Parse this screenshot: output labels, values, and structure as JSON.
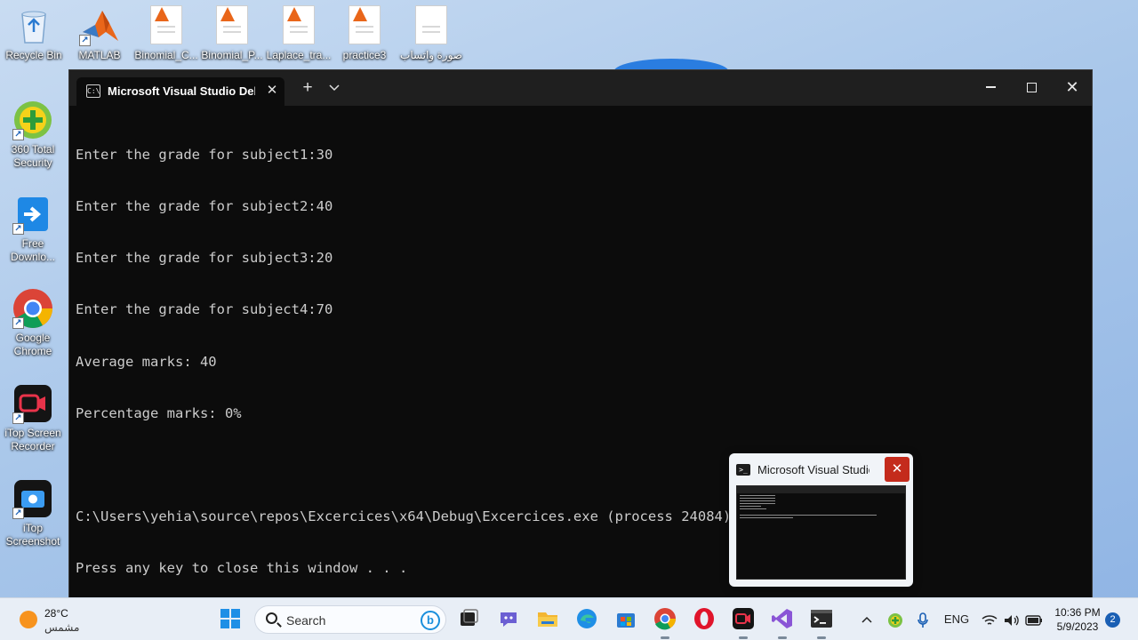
{
  "desktop": {
    "icons": [
      {
        "label": "Recycle Bin",
        "icon": "recycle-bin-icon"
      },
      {
        "label": "MATLAB",
        "icon": "matlab-icon"
      },
      {
        "label": "Binomial_C...",
        "icon": "matlab-document-icon"
      },
      {
        "label": "Binomial_P...",
        "icon": "matlab-document-icon"
      },
      {
        "label": "Laplace_tra...",
        "icon": "matlab-document-icon"
      },
      {
        "label": "practice3",
        "icon": "matlab-document-icon"
      },
      {
        "label": "صورة واتساب",
        "icon": "image-document-icon"
      },
      {
        "label": "360 Total Security",
        "icon": "360-security-icon"
      },
      {
        "label": "Free Downlo...",
        "icon": "free-download-icon"
      },
      {
        "label": "Google Chrome",
        "icon": "chrome-icon"
      },
      {
        "label": "iTop Screen Recorder",
        "icon": "screen-recorder-icon"
      },
      {
        "label": "iTop Screenshot",
        "icon": "screenshot-icon"
      }
    ]
  },
  "terminal": {
    "tab_title": "Microsoft Visual Studio Debug Console",
    "tab_icon_text": "C:\\",
    "lines": [
      "Enter the grade for subject1:30",
      "Enter the grade for subject2:40",
      "Enter the grade for subject3:20",
      "Enter the grade for subject4:70",
      "Average marks: 40",
      "Percentage marks: 0%",
      "",
      "C:\\Users\\yehia\\source\\repos\\Excercices\\x64\\Debug\\Excercices.exe (process 24084) exited with code 0.",
      "Press any key to close this window . . ."
    ]
  },
  "preview": {
    "title": "Microsoft Visual Studio Debug Console"
  },
  "taskbar": {
    "weather_temp": "28°C",
    "weather_condition": "مشمس",
    "search_placeholder": "Search",
    "language": "ENG",
    "time": "10:36 PM",
    "date": "5/9/2023",
    "notification_count": "2",
    "colors": {
      "accent": "#1f8fe6",
      "close_red": "#c42b1c"
    }
  }
}
